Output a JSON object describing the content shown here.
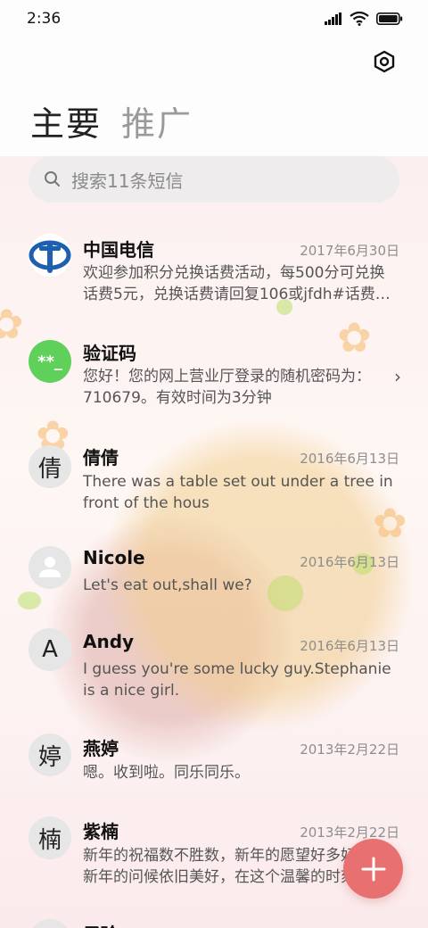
{
  "status_bar": {
    "time": "2:36"
  },
  "tabs": [
    {
      "label": "主要"
    },
    {
      "label": "推广"
    }
  ],
  "search": {
    "placeholder": "搜索11条短信"
  },
  "conversations": [
    {
      "name": "中国电信",
      "date": "2017年6月30日",
      "snippet": "欢迎参加积分兑换话费活动，每500分可兑换话费5元，兑换话费请回复106或jfdh#话费…",
      "avatar": "china-telecom-logo"
    },
    {
      "name": "验证码",
      "date": "",
      "snippet": "您好！您的网上营业厅登录的随机密码为：710679。有效时间为3分钟",
      "avatar_text": "**_"
    },
    {
      "name": "倩倩",
      "date": "2016年6月13日",
      "snippet": "There was a table set out under a tree in front of the hous",
      "avatar_text": "倩"
    },
    {
      "name": "Nicole",
      "date": "2016年6月13日",
      "snippet": "Let's eat out,shall we?",
      "avatar": "person-icon"
    },
    {
      "name": "Andy",
      "date": "2016年6月13日",
      "snippet": "I guess you're some lucky guy.Stephanie is a nice girl.",
      "avatar_text": "A"
    },
    {
      "name": "燕婷",
      "date": "2013年2月22日",
      "snippet": "嗯。收到啦。同乐同乐。",
      "avatar_text": "婷"
    },
    {
      "name": "紫楠",
      "date": "2013年2月22日",
      "snippet": "新年的祝福数不胜数，新年的愿望好多好多，新年的问候依旧美好，在这个温馨的时刻…",
      "avatar_text": "楠"
    },
    {
      "name": "子玲",
      "date": "",
      "snippet": "",
      "avatar_text": ""
    }
  ],
  "colors": {
    "fab": "#e87070",
    "verify_avatar": "#5fd05a",
    "telecom_blue": "#1f5fb0"
  },
  "fab": {
    "icon": "plus-icon"
  }
}
